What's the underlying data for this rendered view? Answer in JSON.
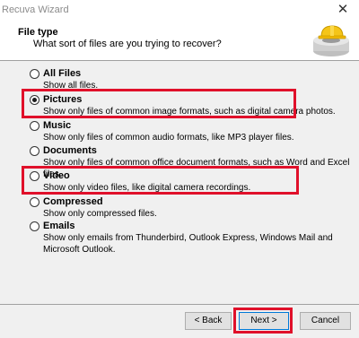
{
  "window": {
    "title": "Recuva Wizard",
    "close_glyph": "✕"
  },
  "header": {
    "title": "File type",
    "subtitle": "What sort of files are you trying to recover?",
    "icon": "recuva-hardhat-drive-icon"
  },
  "options": [
    {
      "label": "All Files",
      "desc": "Show all files.",
      "selected": false,
      "highlighted": false
    },
    {
      "label": "Pictures",
      "desc": "Show only files of common image formats, such as digital camera photos.",
      "selected": true,
      "highlighted": true
    },
    {
      "label": "Music",
      "desc": "Show only files of common audio formats, like MP3 player files.",
      "selected": false,
      "highlighted": false
    },
    {
      "label": "Documents",
      "desc": "Show only files of common office document formats, such as Word and Excel files.",
      "selected": false,
      "highlighted": false
    },
    {
      "label": "Video",
      "desc": "Show only video files, like digital camera recordings.",
      "selected": false,
      "highlighted": true
    },
    {
      "label": "Compressed",
      "desc": "Show only compressed files.",
      "selected": false,
      "highlighted": false
    },
    {
      "label": "Emails",
      "desc": "Show only emails from Thunderbird, Outlook Express, Windows Mail and Microsoft Outlook.",
      "selected": false,
      "highlighted": false
    }
  ],
  "buttons": {
    "back": "< Back",
    "next": "Next >",
    "cancel": "Cancel"
  },
  "colors": {
    "highlight": "#e0102a",
    "content_bg": "#f0f0f0"
  }
}
